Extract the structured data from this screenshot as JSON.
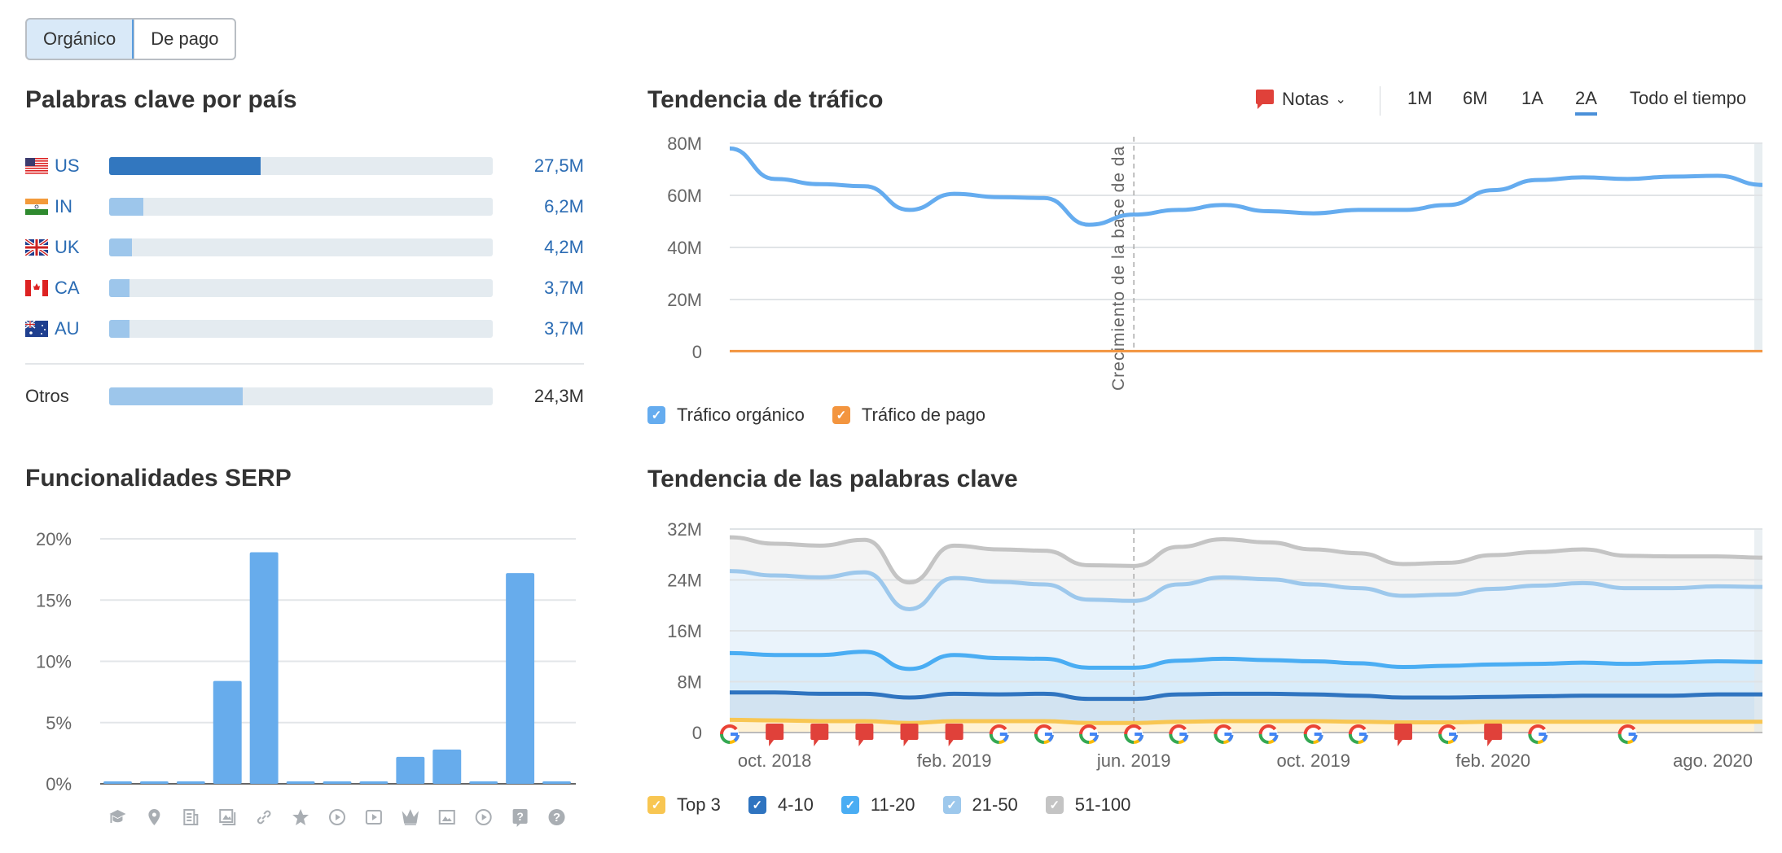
{
  "toggle": {
    "options": [
      "Orgánico",
      "De pago"
    ],
    "active": 0
  },
  "countries": {
    "title": "Palabras clave por país",
    "items": [
      {
        "code": "US",
        "value": 27.5,
        "label": "27,5M"
      },
      {
        "code": "IN",
        "value": 6.2,
        "label": "6,2M"
      },
      {
        "code": "UK",
        "value": 4.2,
        "label": "4,2M"
      },
      {
        "code": "CA",
        "value": 3.7,
        "label": "3,7M"
      },
      {
        "code": "AU",
        "value": 3.7,
        "label": "3,7M"
      }
    ],
    "other": {
      "code": "Otros",
      "value": 24.3,
      "label": "24,3M"
    }
  },
  "serp": {
    "title": "Funcionalidades SERP",
    "chart_data": {
      "type": "bar",
      "yticks": [
        "0%",
        "5%",
        "10%",
        "15%",
        "20%"
      ],
      "ylim": [
        0,
        20
      ],
      "categories": [
        "graduation-cap-icon",
        "map-pin-icon",
        "news-icon",
        "image-pack-icon",
        "link-icon",
        "star-icon",
        "video-circle-icon",
        "video-square-icon",
        "crown-icon",
        "image-icon",
        "video-play-icon",
        "faq-bubble-icon",
        "question-icon"
      ],
      "values": [
        0.2,
        0.2,
        0.2,
        8.4,
        18.9,
        0.2,
        0.2,
        0.2,
        2.2,
        2.8,
        0.2,
        17.2,
        0.2
      ],
      "color": "#67acec"
    }
  },
  "traffic": {
    "title": "Tendencia de tráfico",
    "notes_label": "Notas",
    "ranges": [
      "1M",
      "6M",
      "1A",
      "2A",
      "Todo el tiempo"
    ],
    "active_range": "2A",
    "annotation": "Crecimiento de la base de da",
    "legend": [
      {
        "label": "Tráfico orgánico",
        "color": "#65acef"
      },
      {
        "label": "Tráfico de pago",
        "color": "#f3953f"
      }
    ],
    "chart_data": {
      "type": "line",
      "x": [
        "2018-09",
        "2018-10",
        "2018-11",
        "2018-12",
        "2019-01",
        "2019-02",
        "2019-03",
        "2019-04",
        "2019-05",
        "2019-06",
        "2019-07",
        "2019-08",
        "2019-09",
        "2019-10",
        "2019-11",
        "2019-12",
        "2020-01",
        "2020-02",
        "2020-03",
        "2020-04",
        "2020-05",
        "2020-06",
        "2020-07",
        "2020-08"
      ],
      "yticks": [
        "0",
        "20M",
        "40M",
        "60M",
        "80M"
      ],
      "ylim": [
        0,
        80
      ],
      "annotation_x": "2019-06",
      "series": [
        {
          "name": "Tráfico orgánico",
          "color": "#65acef",
          "values": [
            78,
            66.3,
            64.3,
            63.5,
            54.4,
            60.6,
            59.3,
            59,
            48.7,
            52.6,
            54.4,
            56.3,
            53.9,
            53.1,
            54.4,
            54.4,
            56.3,
            62,
            65.9,
            66.9,
            66.3,
            67.2,
            67.5,
            64
          ]
        },
        {
          "name": "Tráfico de pago",
          "color": "#f3953f",
          "values": [
            0.2,
            0.2,
            0.2,
            0.2,
            0.2,
            0.2,
            0.2,
            0.2,
            0.2,
            0.2,
            0.2,
            0.2,
            0.2,
            0.2,
            0.2,
            0.2,
            0.2,
            0.2,
            0.2,
            0.2,
            0.2,
            0.2,
            0.2,
            0.2
          ]
        }
      ]
    }
  },
  "keywords": {
    "title": "Tendencia de las palabras clave",
    "legend": [
      {
        "label": "Top 3",
        "color": "#f8c652"
      },
      {
        "label": "4-10",
        "color": "#2f74c0"
      },
      {
        "label": "11-20",
        "color": "#4aadf3"
      },
      {
        "label": "21-50",
        "color": "#9dc8ec"
      },
      {
        "label": "51-100",
        "color": "#c4c4c4"
      }
    ],
    "chart_data": {
      "type": "area",
      "x": [
        "2018-09",
        "2018-10",
        "2018-11",
        "2018-12",
        "2019-01",
        "2019-02",
        "2019-03",
        "2019-04",
        "2019-05",
        "2019-06",
        "2019-07",
        "2019-08",
        "2019-09",
        "2019-10",
        "2019-11",
        "2019-12",
        "2020-01",
        "2020-02",
        "2020-03",
        "2020-04",
        "2020-05",
        "2020-06",
        "2020-07",
        "2020-08"
      ],
      "xticks": [
        {
          "x": "2018-10",
          "label": "oct. 2018"
        },
        {
          "x": "2019-02",
          "label": "feb. 2019"
        },
        {
          "x": "2019-06",
          "label": "jun. 2019"
        },
        {
          "x": "2019-10",
          "label": "oct. 2019"
        },
        {
          "x": "2020-02",
          "label": "feb. 2020"
        },
        {
          "x": "2020-08",
          "label": "ago. 2020"
        }
      ],
      "yticks": [
        "0",
        "8M",
        "16M",
        "24M",
        "32M"
      ],
      "ylim": [
        0,
        32
      ],
      "annotation_x": "2019-06",
      "series": [
        {
          "name": "51-100",
          "color": "#c4c4c4",
          "fill": "#f3f3f3",
          "values": [
            30.7,
            29.7,
            29.4,
            30.3,
            23.6,
            29.4,
            28.8,
            28.6,
            26.3,
            26.2,
            29.2,
            30.4,
            29.9,
            28.8,
            28.2,
            26.5,
            26.7,
            27.9,
            28.4,
            28.8,
            27.8,
            27.7,
            27.7,
            27.5
          ]
        },
        {
          "name": "21-50",
          "color": "#9dc8ec",
          "fill": "#eaf3fb",
          "values": [
            25.4,
            24.7,
            24.4,
            25.2,
            19.4,
            24.3,
            23.7,
            23.3,
            20.9,
            20.7,
            23.3,
            24.4,
            24.1,
            23.3,
            22.7,
            21.5,
            21.7,
            22.6,
            23.1,
            23.5,
            22.7,
            22.7,
            23.0,
            22.9
          ]
        },
        {
          "name": "11-20",
          "color": "#4aadf3",
          "fill": "#d8ecfa",
          "values": [
            12.5,
            12.2,
            12.2,
            12.7,
            10.0,
            12.2,
            11.7,
            11.6,
            10.2,
            10.2,
            11.3,
            11.6,
            11.4,
            11.2,
            10.9,
            10.3,
            10.5,
            10.7,
            10.8,
            11.0,
            10.8,
            11.0,
            11.2,
            11.1
          ]
        },
        {
          "name": "4-10",
          "color": "#2f74c0",
          "fill": "#d2e3f1",
          "values": [
            6.3,
            6.3,
            6.1,
            6.1,
            5.5,
            6.1,
            6.0,
            6.1,
            5.3,
            5.3,
            6.0,
            6.1,
            6.1,
            6.0,
            5.8,
            5.5,
            5.5,
            5.6,
            5.7,
            5.8,
            5.8,
            5.8,
            6.0,
            6.0
          ]
        },
        {
          "name": "Top 3",
          "color": "#f8c652",
          "fill": "#fff2d4",
          "values": [
            2.0,
            1.9,
            1.8,
            1.8,
            1.5,
            1.8,
            1.8,
            1.8,
            1.5,
            1.5,
            1.7,
            1.8,
            1.8,
            1.8,
            1.7,
            1.6,
            1.6,
            1.7,
            1.7,
            1.7,
            1.7,
            1.7,
            1.7,
            1.7
          ]
        }
      ],
      "markers": [
        {
          "x": "2018-09",
          "type": "google"
        },
        {
          "x": "2018-10",
          "type": "note"
        },
        {
          "x": "2018-11",
          "type": "note"
        },
        {
          "x": "2018-12",
          "type": "note"
        },
        {
          "x": "2019-01",
          "type": "note"
        },
        {
          "x": "2019-02",
          "type": "note"
        },
        {
          "x": "2019-03",
          "type": "google"
        },
        {
          "x": "2019-04",
          "type": "google"
        },
        {
          "x": "2019-05",
          "type": "google"
        },
        {
          "x": "2019-06",
          "type": "google"
        },
        {
          "x": "2019-07",
          "type": "google"
        },
        {
          "x": "2019-08",
          "type": "google"
        },
        {
          "x": "2019-09",
          "type": "google"
        },
        {
          "x": "2019-10",
          "type": "google"
        },
        {
          "x": "2019-11",
          "type": "google"
        },
        {
          "x": "2019-12",
          "type": "note"
        },
        {
          "x": "2020-01",
          "type": "google"
        },
        {
          "x": "2020-02",
          "type": "note"
        },
        {
          "x": "2020-03",
          "type": "google"
        },
        {
          "x": "2020-05",
          "type": "google"
        }
      ]
    }
  },
  "colors": {
    "accent": "#4a90d9",
    "link": "#2a6bb3",
    "bar_dark": "#3277bf",
    "bar_light": "#9dc6eb",
    "track": "#e4ebf0",
    "note_red": "#e0413a"
  }
}
